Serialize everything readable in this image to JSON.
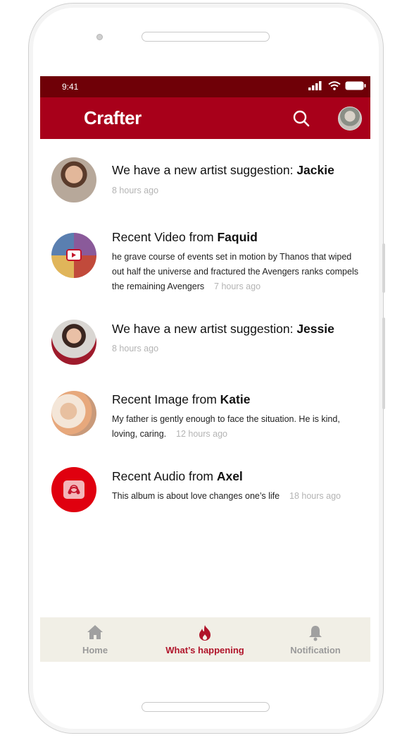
{
  "statusbar": {
    "time": "9:41"
  },
  "appbar": {
    "title": "Crafter"
  },
  "feed": [
    {
      "title_prefix": "We have a new artist suggestion: ",
      "title_name": "Jackie",
      "body": "",
      "time": "8 hours ago"
    },
    {
      "title_prefix": "Recent Video from ",
      "title_name": "Faquid",
      "body": "he grave course of events set in motion by Thanos that wiped out half the universe and fractured the Avengers ranks compels the remaining Avengers",
      "time": "7 hours ago"
    },
    {
      "title_prefix": "We have a new artist suggestion: ",
      "title_name": "Jessie",
      "body": "",
      "time": "8 hours ago"
    },
    {
      "title_prefix": "Recent Image from ",
      "title_name": "Katie",
      "body": "My father is gently enough to face the situation. He is kind, loving, caring.",
      "time": "12 hours ago"
    },
    {
      "title_prefix": "Recent Audio from ",
      "title_name": "Axel",
      "body": "This album is about love changes one’s life",
      "time": "18 hours ago"
    }
  ],
  "tabs": [
    {
      "label": "Home",
      "icon": "home-icon",
      "active": false
    },
    {
      "label": "What’s happening",
      "icon": "flame-icon",
      "active": true
    },
    {
      "label": "Notification",
      "icon": "bell-icon",
      "active": false
    }
  ],
  "colors": {
    "statusbar": "#6f0007",
    "appbar": "#a8001a",
    "accent": "#b0142a",
    "tabbar": "#f1efe6"
  }
}
